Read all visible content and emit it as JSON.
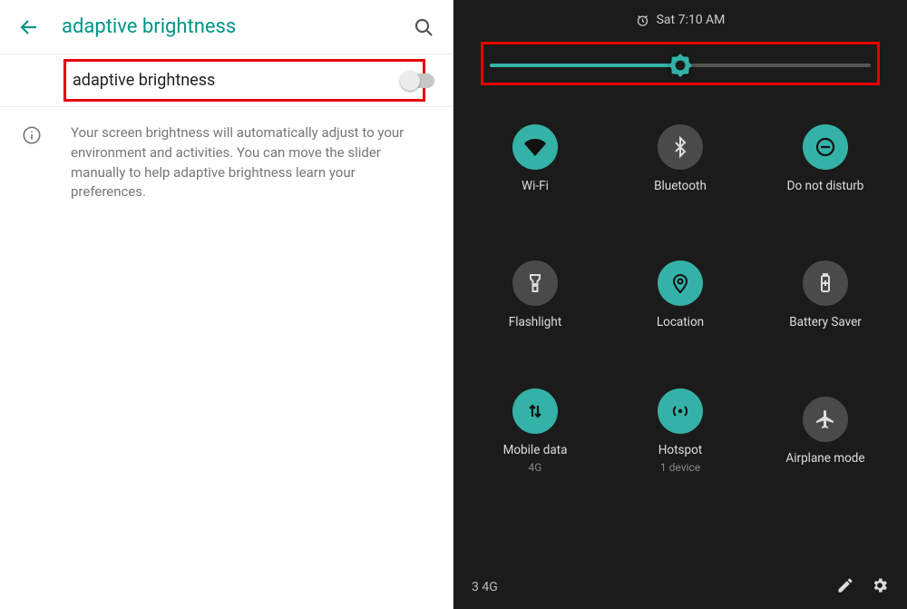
{
  "colors": {
    "accent": "#009688",
    "qs_accent": "#34b2a7",
    "highlight": "#e60000"
  },
  "left": {
    "title": "adaptive brightness",
    "toggle": {
      "label": "adaptive brightness",
      "state": "off"
    },
    "description": "Your screen brightness will automatically adjust to your environment and activities. You can move the slider manually to help adaptive brightness learn your preferences."
  },
  "right": {
    "status_time": "Sat 7:10 AM",
    "brightness_percent": 50,
    "tiles": [
      {
        "id": "wifi",
        "label": "Wi-Fi",
        "sub": "",
        "on": true
      },
      {
        "id": "bluetooth",
        "label": "Bluetooth",
        "sub": "",
        "on": false
      },
      {
        "id": "do-not-disturb",
        "label": "Do not disturb",
        "sub": "",
        "on": true
      },
      {
        "id": "flashlight",
        "label": "Flashlight",
        "sub": "",
        "on": false
      },
      {
        "id": "location",
        "label": "Location",
        "sub": "",
        "on": true
      },
      {
        "id": "battery-saver",
        "label": "Battery Saver",
        "sub": "",
        "on": false
      },
      {
        "id": "mobile-data",
        "label": "Mobile data",
        "sub": "4G",
        "on": true
      },
      {
        "id": "hotspot",
        "label": "Hotspot",
        "sub": "1 device",
        "on": true
      },
      {
        "id": "airplane-mode",
        "label": "Airplane mode",
        "sub": "",
        "on": false
      }
    ],
    "footer_signal": "3 4G"
  }
}
